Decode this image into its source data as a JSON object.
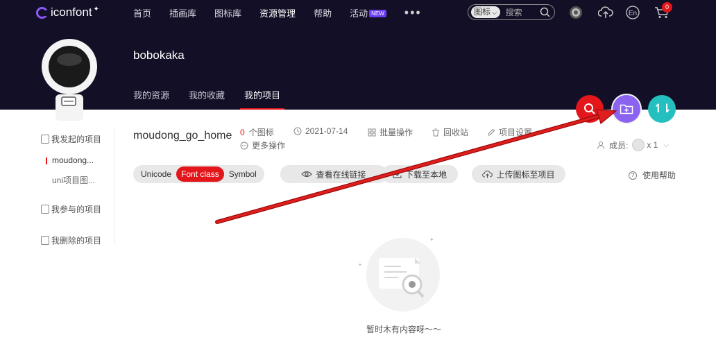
{
  "topnav": {
    "logo": "iconfont",
    "items": [
      {
        "label": "首页"
      },
      {
        "label": "插画库"
      },
      {
        "label": "图标库"
      },
      {
        "label": "资源管理"
      },
      {
        "label": "帮助"
      },
      {
        "label": "活动"
      }
    ],
    "new_badge": "NEW",
    "search_type": "图标",
    "search_placeholder": "搜索",
    "lang": "En",
    "cart_count": "0"
  },
  "profile": {
    "username": "bobokaka",
    "tabs": [
      {
        "label": "我的资源"
      },
      {
        "label": "我的收藏"
      },
      {
        "label": "我的项目"
      }
    ],
    "fab_sort_label": "↿⇂"
  },
  "sidebar": {
    "groups": [
      {
        "label": "我发起的项目"
      },
      {
        "label": "我参与的项目"
      },
      {
        "label": "我删除的项目"
      }
    ],
    "projects": [
      {
        "label": "moudong..."
      },
      {
        "label": "uni项目图..."
      }
    ]
  },
  "project": {
    "title": "moudong_go_home",
    "icon_count_num": "0",
    "icon_count_label": "个图标",
    "date": "2021-07-14",
    "batch_label": "批量操作",
    "recycle_label": "回收站",
    "settings_label": "项目设置",
    "more_label": "更多操作",
    "members_label": "成员:",
    "members_count": "x 1"
  },
  "toolbar": {
    "formats": [
      {
        "label": "Unicode"
      },
      {
        "label": "Font class"
      },
      {
        "label": "Symbol"
      }
    ],
    "view_link_label": "查看在线链接",
    "download_label": "下载至本地",
    "upload_label": "上传图标至项目",
    "help_label": "使用帮助"
  },
  "empty_state": {
    "text": "暂时木有内容呀～～"
  },
  "colors": {
    "nav_bg": "#120f26",
    "accent_red": "#e3161b",
    "purple": "#8a63f0",
    "teal": "#23c0bf"
  }
}
